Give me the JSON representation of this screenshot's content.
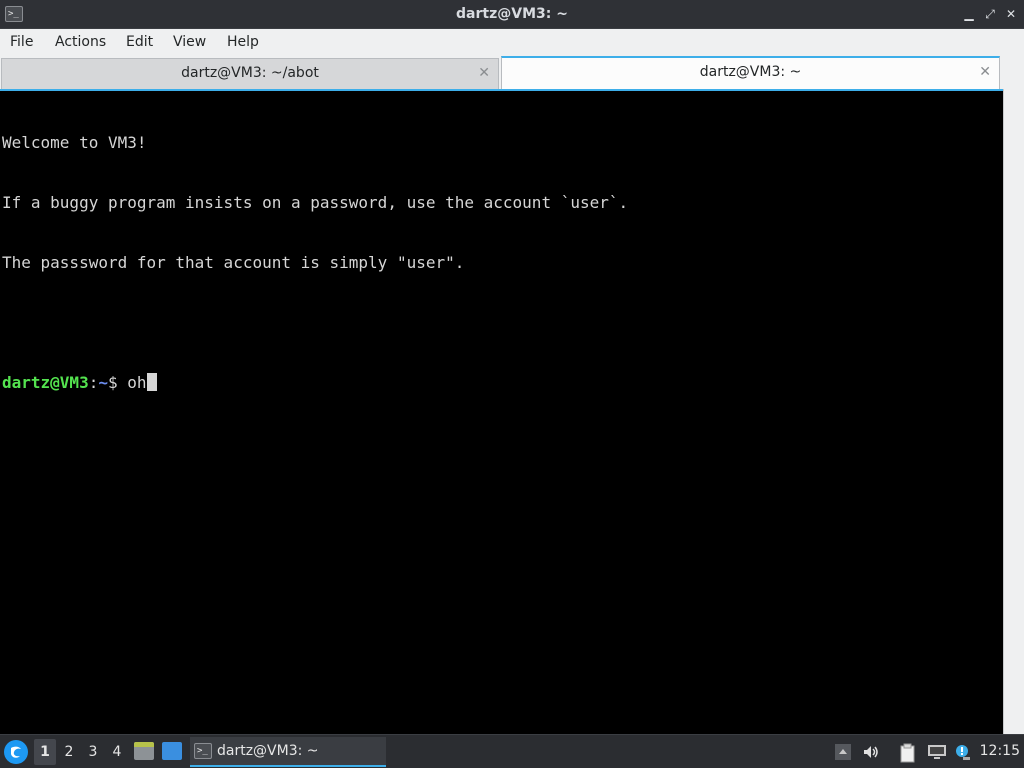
{
  "window": {
    "title": "dartz@VM3: ~",
    "app_icon_glyph": ">_",
    "buttons": {
      "minimize": "▁",
      "maximize": "⤢",
      "close": "✕"
    }
  },
  "menu": {
    "items": [
      "File",
      "Actions",
      "Edit",
      "View",
      "Help"
    ]
  },
  "tabs": [
    {
      "label": "dartz@VM3: ~/abot",
      "active": false,
      "close": "✕"
    },
    {
      "label": "dartz@VM3: ~",
      "active": true,
      "close": "✕"
    }
  ],
  "terminal": {
    "lines": [
      "Welcome to VM3!",
      "If a buggy program insists on a password, use the account `user`.",
      "The passsword for that account is simply \"user\".",
      ""
    ],
    "prompt": {
      "user_host": "dartz@VM3",
      "sep": ":",
      "path": "~",
      "symbol": "$ ",
      "input": "oh"
    }
  },
  "taskbar": {
    "launcher_icon": "start-menu-icon",
    "workspaces": [
      "1",
      "2",
      "3",
      "4"
    ],
    "current_workspace": "1",
    "task": {
      "label": "dartz@VM3: ~",
      "icon_glyph": ">_"
    },
    "clock": "12:15"
  },
  "colors": {
    "accent": "#3daee9",
    "prompt_user": "#54e34f",
    "prompt_path": "#6d8ef0",
    "terminal_bg": "#000000",
    "terminal_fg": "#d6d6d6"
  }
}
